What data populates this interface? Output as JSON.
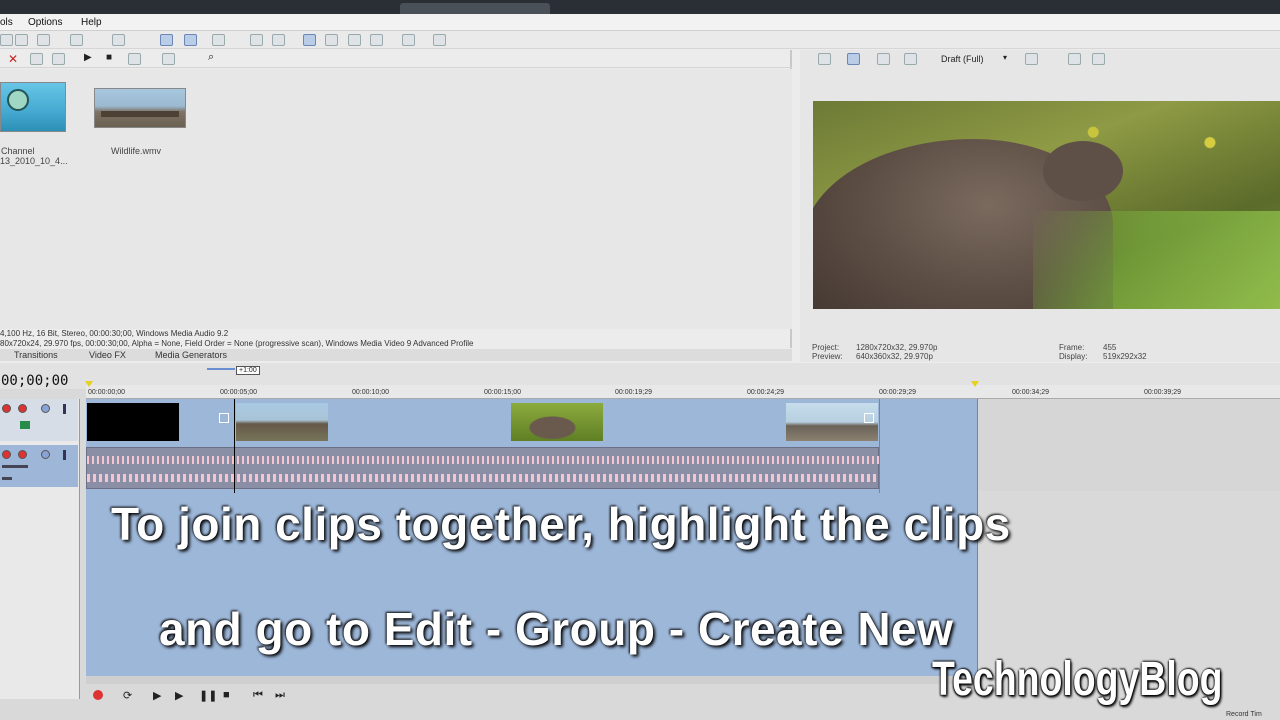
{
  "menu": {
    "tools": "ols",
    "options": "Options",
    "help": "Help"
  },
  "media": {
    "items": [
      {
        "name_line1": "Channel",
        "name_line2": "13_2010_10_4..."
      },
      {
        "name": "Wildlife.wmv"
      }
    ],
    "status_audio": "4,100 Hz, 16 Bit, Stereo, 00:00:30;00, Windows Media Audio 9.2",
    "status_video": "80x720x24, 29.970 fps, 00:00:30;00, Alpha = None, Field Order = None (progressive scan), Windows Media Video 9 Advanced Profile",
    "tabs": [
      "Transitions",
      "Video FX",
      "Media Generators"
    ]
  },
  "preview": {
    "quality": "Draft (Full)",
    "project_label": "Project:",
    "project_value": "1280x720x32, 29.970p",
    "preview_label": "Preview:",
    "preview_value": "640x360x32, 29.970p",
    "frame_label": "Frame:",
    "frame_value": "455",
    "display_label": "Display:",
    "display_value": "519x292x32"
  },
  "timeline": {
    "timecode": "00;00;00",
    "playhead_flag": "+1:00",
    "ruler": [
      "00:00:00;00",
      "00:00:05;00",
      "00:00:10;00",
      "00:00:15;00",
      "00:00:19;29",
      "00:00:24;29",
      "00:00:29;29",
      "00:00:34;29",
      "00:00:39;29"
    ]
  },
  "captions": {
    "line1": "To join clips together, highlight the clips",
    "line2": "and go to Edit - Group - Create New"
  },
  "watermark": "TechnologyBlog",
  "footer": {
    "record_time": "Record Tim"
  },
  "colors": {
    "track_bg": "#9db7d9",
    "audio_clip": "#8a8fa6",
    "wave": "#f3c6d2"
  }
}
